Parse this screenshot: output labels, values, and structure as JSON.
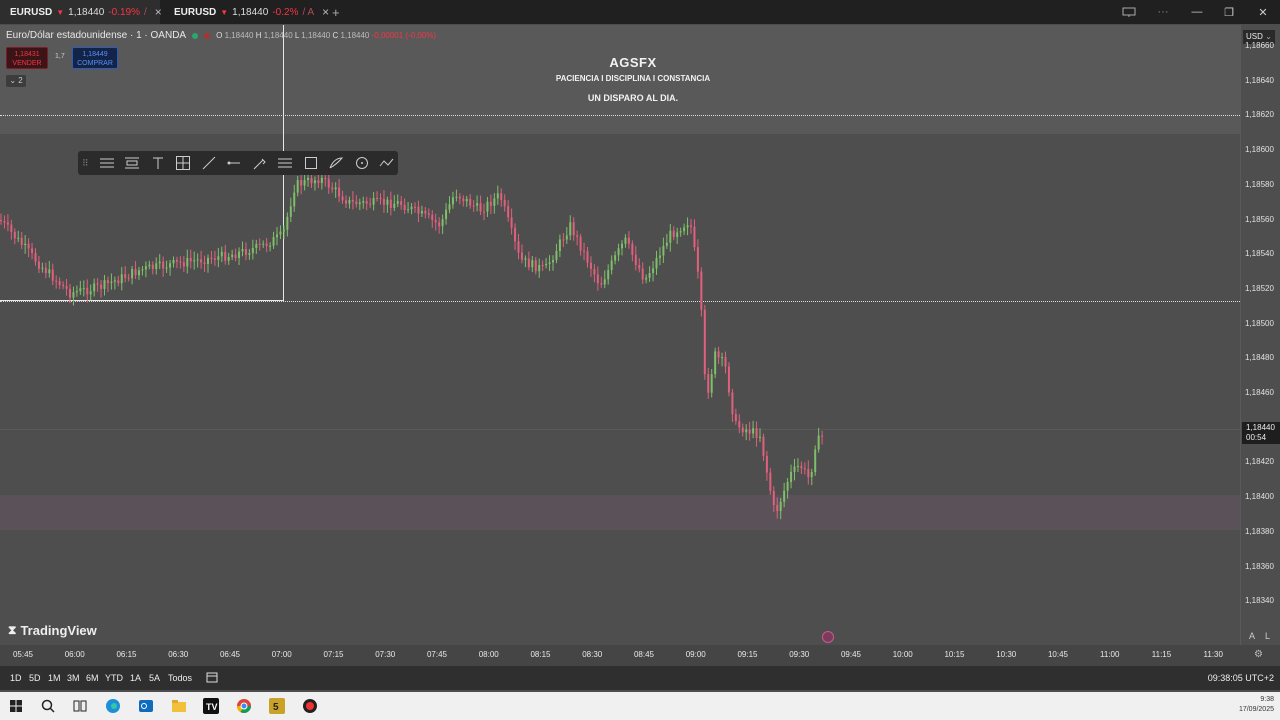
{
  "tabs": [
    {
      "symbol": "EURUSD",
      "price": "1,18440",
      "change": "-0.19%",
      "suffix": "/",
      "active": true
    },
    {
      "symbol": "EURUSD",
      "price": "1,18440",
      "change": "-0.2%",
      "suffix": "/ A",
      "active": false
    }
  ],
  "legend": {
    "title": "Euro/Dólar estadounidense · 1 · OANDA",
    "open_label": "O",
    "open": "1,18440",
    "high_label": "H",
    "high": "1,18440",
    "low_label": "L",
    "low": "1,18440",
    "close_label": "C",
    "close": "1,18440",
    "change": "-0,00001 (-0,00%)"
  },
  "trade": {
    "sell_price": "1,18431",
    "sell_label": "VENDER",
    "spread": "1,7",
    "buy_price": "1,18449",
    "buy_label": "COMPRAR",
    "collapse_label": "⌄ 2"
  },
  "watermark": {
    "title": "AGSFX",
    "line1": "PACIENCIA I DISCIPLINA I CONSTANCIA",
    "line2": "UN DISPARO AL DIA."
  },
  "brand": "TradingView",
  "price_axis": {
    "currency": "USD",
    "labels": [
      "1,18660",
      "1,18640",
      "1,18620",
      "1,18600",
      "1,18580",
      "1,18560",
      "1,18540",
      "1,18520",
      "1,18500",
      "1,18480",
      "1,18460",
      "1,18440",
      "1,18420",
      "1,18400",
      "1,18380",
      "1,18360",
      "1,18340"
    ],
    "current_price": "1,18440",
    "countdown": "00:54",
    "auto_label": "A",
    "log_label": "L"
  },
  "time_axis": [
    "05:45",
    "06:00",
    "06:15",
    "06:30",
    "06:45",
    "07:00",
    "07:15",
    "07:30",
    "07:45",
    "08:00",
    "08:15",
    "08:30",
    "08:45",
    "09:00",
    "09:15",
    "09:30",
    "09:45",
    "10:00",
    "10:15",
    "10:30",
    "10:45",
    "11:00",
    "11:15",
    "11:30"
  ],
  "ranges": [
    "1D",
    "5D",
    "1M",
    "3M",
    "6M",
    "YTD",
    "1A",
    "5A",
    "Todos"
  ],
  "clock": "09:38:05 UTC+2",
  "tray": {
    "time": "9:38",
    "date": "17/09/2025"
  },
  "colors": {
    "up": "#7fbf6a",
    "down": "#e0607e",
    "background": "#4e4e4e",
    "sell": "#f23645",
    "buy": "#2f5bb8"
  }
}
